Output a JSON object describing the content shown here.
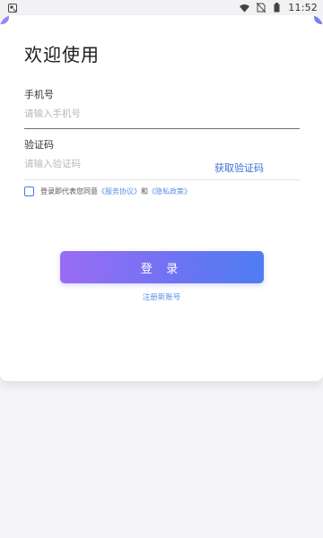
{
  "status_bar": {
    "time": "11:52",
    "icons": [
      "notification-icon",
      "wifi-icon",
      "no-sim-icon",
      "battery-icon"
    ]
  },
  "login": {
    "title": "欢迎使用",
    "phone_label": "手机号",
    "phone_placeholder": "请输入手机号",
    "phone_value": "",
    "code_label": "验证码",
    "code_placeholder": "请输入验证码",
    "code_value": "",
    "get_code_label": "获取验证码",
    "agree": {
      "checked": false,
      "prefix": "登录即代表您同意",
      "service_link": "《服务协议》",
      "conjunction": "和",
      "privacy_link": "《隐私政策》"
    },
    "login_button": "登 录",
    "register_link": "注册新账号"
  },
  "colors": {
    "accent": "#4f7df2",
    "gradient_start": "#9a6cf4",
    "gradient_end": "#4f7df2",
    "link": "#5b8fe6"
  }
}
